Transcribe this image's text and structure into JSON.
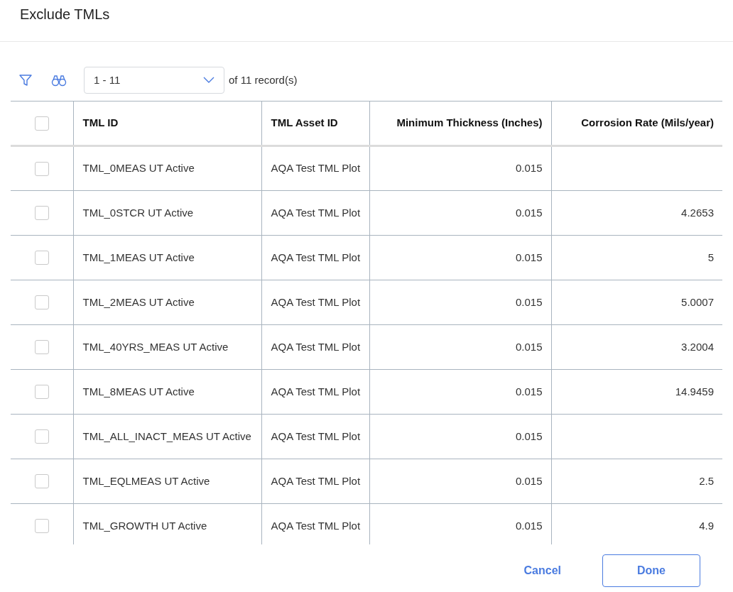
{
  "dialog": {
    "title": "Exclude TMLs"
  },
  "toolbar": {
    "range": "1 - 11",
    "of": "of",
    "total": "11",
    "records": "record(s)"
  },
  "table": {
    "header_checked": false,
    "columns": [
      "TML ID",
      "TML Asset ID",
      "Minimum Thickness (Inches)",
      "Corrosion Rate (Mils/year)"
    ],
    "rows": [
      {
        "checked": false,
        "cells": [
          "TML_0MEAS UT Active",
          "AQA Test TML Plot",
          "0.015",
          ""
        ]
      },
      {
        "checked": false,
        "cells": [
          "TML_0STCR UT Active",
          "AQA Test TML Plot",
          "0.015",
          "4.2653"
        ]
      },
      {
        "checked": false,
        "cells": [
          "TML_1MEAS UT Active",
          "AQA Test TML Plot",
          "0.015",
          "5"
        ]
      },
      {
        "checked": false,
        "cells": [
          "TML_2MEAS UT Active",
          "AQA Test TML Plot",
          "0.015",
          "5.0007"
        ]
      },
      {
        "checked": false,
        "cells": [
          "TML_40YRS_MEAS UT Active",
          "AQA Test TML Plot",
          "0.015",
          "3.2004"
        ]
      },
      {
        "checked": false,
        "cells": [
          "TML_8MEAS UT Active",
          "AQA Test TML Plot",
          "0.015",
          "14.9459"
        ]
      },
      {
        "checked": false,
        "cells": [
          "TML_ALL_INACT_MEAS UT Active",
          "AQA Test TML Plot",
          "0.015",
          ""
        ]
      },
      {
        "checked": false,
        "cells": [
          "TML_EQLMEAS UT Active",
          "AQA Test TML Plot",
          "0.015",
          "2.5"
        ]
      },
      {
        "checked": false,
        "cells": [
          "TML_GROWTH UT Active",
          "AQA Test TML Plot",
          "0.015",
          "4.9"
        ]
      }
    ]
  },
  "buttons": {
    "cancel": "Cancel",
    "done": "Done"
  }
}
